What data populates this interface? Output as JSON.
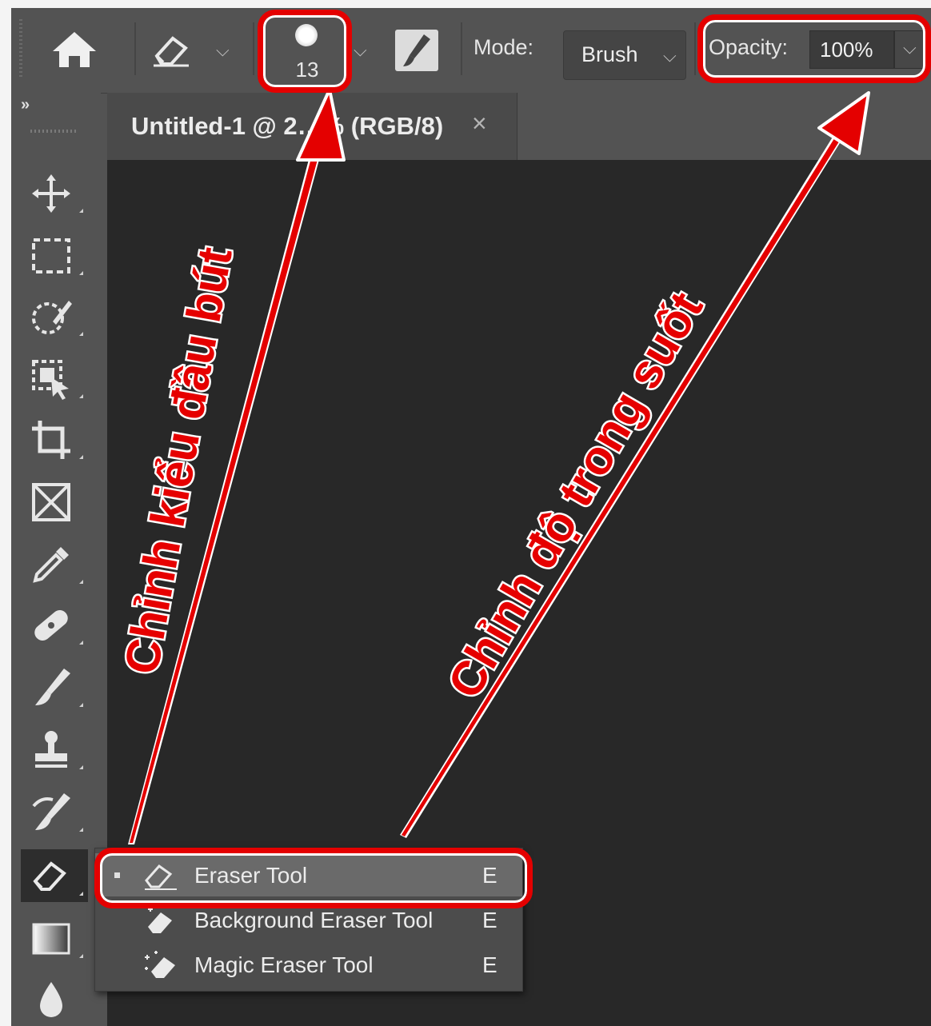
{
  "options_bar": {
    "brush_size": "13",
    "mode_label": "Mode:",
    "mode_value": "Brush",
    "opacity_label": "Opacity:",
    "opacity_value": "100%"
  },
  "document_tab": {
    "title": "Untitled-1 @ 2…% (RGB/8)",
    "close_glyph": "×"
  },
  "toolbar": {
    "collapse_glyph": "»",
    "tools": [
      "move-tool",
      "rectangular-marquee-tool",
      "quick-selection-tool",
      "object-selection-tool",
      "crop-tool",
      "frame-tool",
      "eyedropper-tool",
      "spot-healing-brush-tool",
      "brush-tool",
      "clone-stamp-tool",
      "history-brush-tool",
      "eraser-tool",
      "gradient-tool",
      "blur-tool"
    ]
  },
  "flyout": {
    "items": [
      {
        "label": "Eraser Tool",
        "shortcut": "E",
        "selected": true
      },
      {
        "label": "Background Eraser Tool",
        "shortcut": "E",
        "selected": false
      },
      {
        "label": "Magic Eraser Tool",
        "shortcut": "E",
        "selected": false
      }
    ]
  },
  "annotations": {
    "brush_tip": "Chỉnh kiểu đầu bút",
    "opacity": "Chỉnh độ trong suốt",
    "color": "#e60000"
  }
}
